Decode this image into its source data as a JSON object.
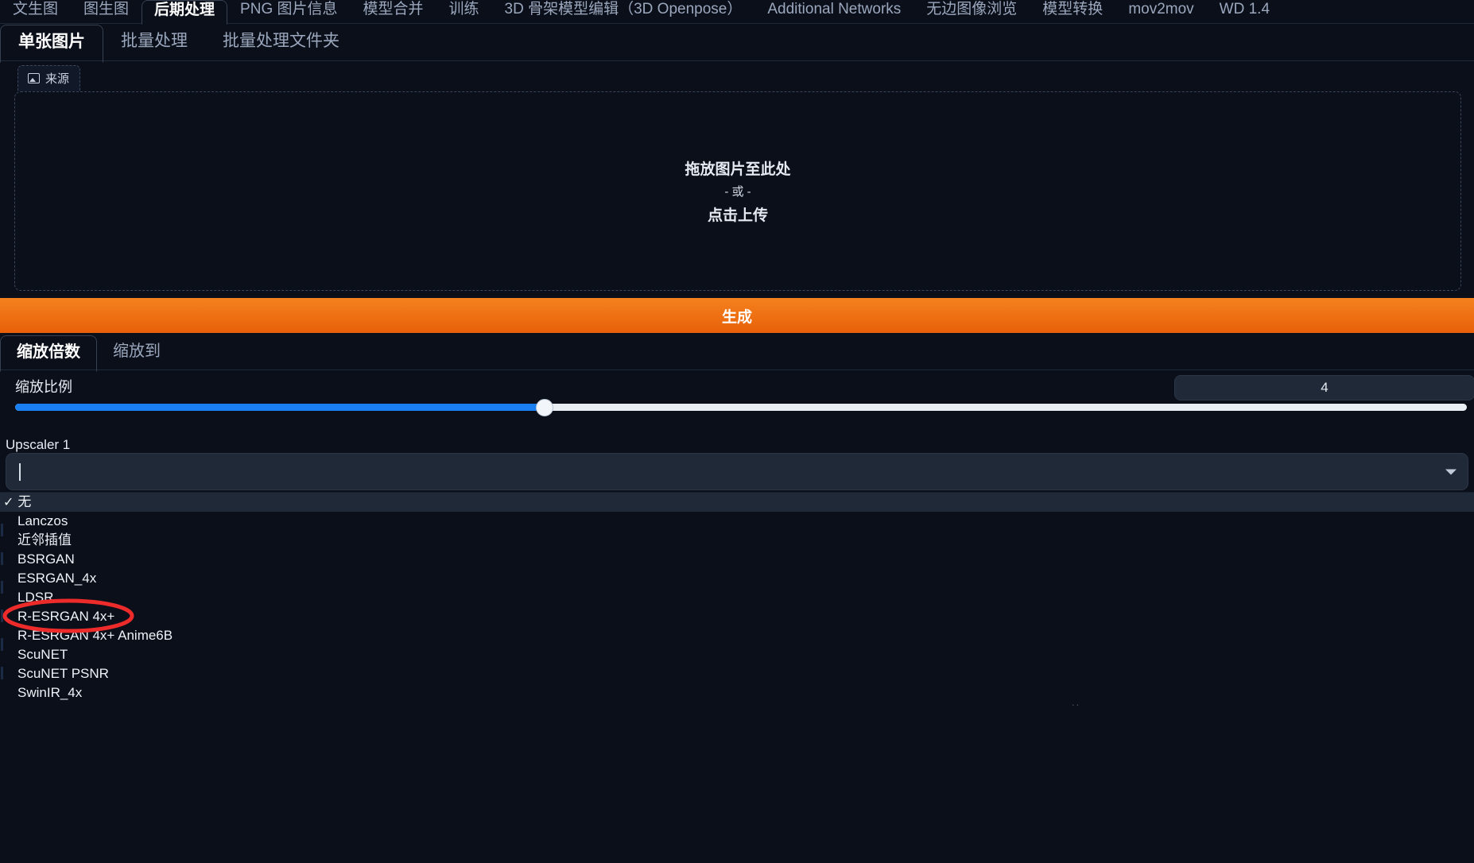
{
  "app": {
    "theme_bg": "#0b0f19",
    "accent_orange": "#ee6f12",
    "accent_blue": "#1a7ff0",
    "annotation_color": "#ee2b2b"
  },
  "top_tabs": {
    "active": "后期处理",
    "items": [
      {
        "label": "文生图"
      },
      {
        "label": "图生图"
      },
      {
        "label": "后期处理"
      },
      {
        "label": "PNG 图片信息"
      },
      {
        "label": "模型合并"
      },
      {
        "label": "训练"
      },
      {
        "label": "3D 骨架模型编辑（3D Openpose）"
      },
      {
        "label": "Additional Networks"
      },
      {
        "label": "无边图像浏览"
      },
      {
        "label": "模型转换"
      },
      {
        "label": "mov2mov"
      },
      {
        "label": "WD 1.4"
      }
    ]
  },
  "sub_tabs": {
    "active": "单张图片",
    "items": [
      {
        "label": "单张图片"
      },
      {
        "label": "批量处理"
      },
      {
        "label": "批量处理文件夹"
      }
    ]
  },
  "source": {
    "tab_label": "来源",
    "icon": "image-icon",
    "dropzone": {
      "main_text": "拖放图片至此处",
      "or_text": "- 或 -",
      "upload_text": "点击上传"
    }
  },
  "generate": {
    "label": "生成"
  },
  "scale_tabs": {
    "active": "缩放倍数",
    "items": [
      {
        "label": "缩放倍数"
      },
      {
        "label": "缩放到"
      }
    ]
  },
  "scale_slider": {
    "label": "缩放比例",
    "value": "4",
    "min": 1,
    "max": 8,
    "fill_percent": 36.5
  },
  "upscaler": {
    "label": "Upscaler 1",
    "input_value": "",
    "placeholder": "",
    "arrow_icon": "chevron-down-icon",
    "selected": "无",
    "options": [
      {
        "label": "无",
        "selected": true
      },
      {
        "label": "Lanczos",
        "selected": false
      },
      {
        "label": "近邻插值",
        "selected": false
      },
      {
        "label": "BSRGAN",
        "selected": false
      },
      {
        "label": "ESRGAN_4x",
        "selected": false
      },
      {
        "label": "LDSR",
        "selected": false
      },
      {
        "label": "R-ESRGAN 4x+",
        "selected": false
      },
      {
        "label": "R-ESRGAN 4x+ Anime6B",
        "selected": false
      },
      {
        "label": "ScuNET",
        "selected": false
      },
      {
        "label": "ScuNET PSNR",
        "selected": false
      },
      {
        "label": "SwinIR_4x",
        "selected": false
      }
    ]
  },
  "annotation": {
    "shape": "ellipse",
    "target_label": "R-ESRGAN 4x+",
    "color": "#ee2b2b"
  },
  "bottom_marks": {
    "text": ".."
  }
}
